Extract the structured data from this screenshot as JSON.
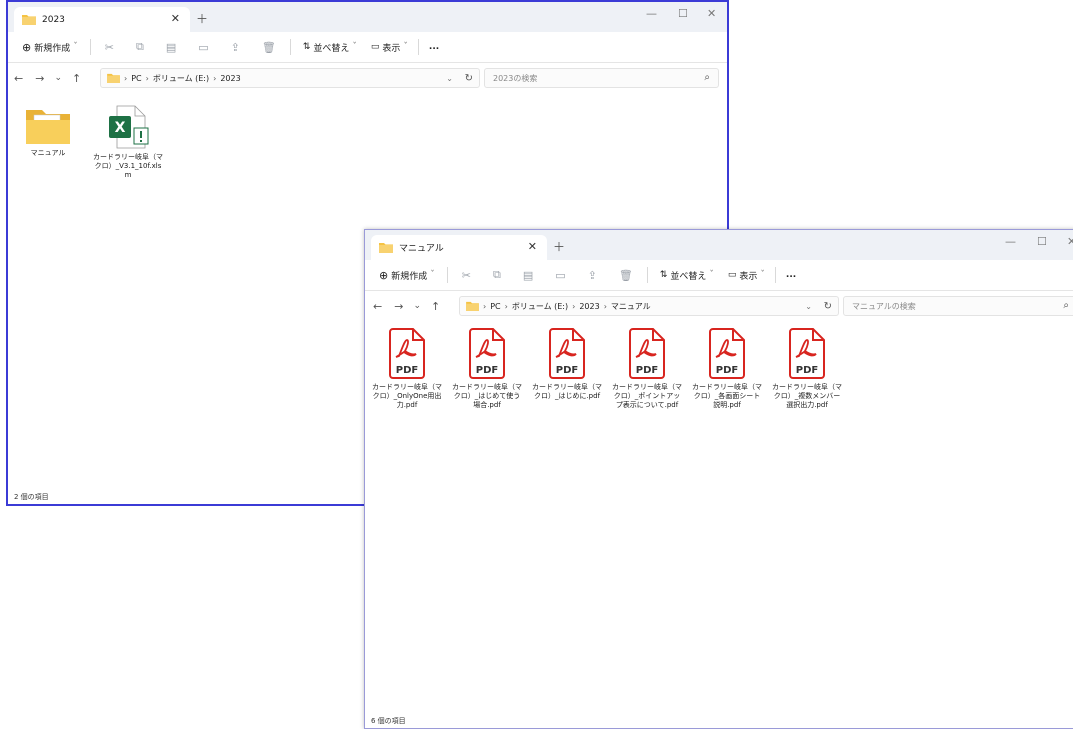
{
  "window1": {
    "tab_title": "2023",
    "toolbar": {
      "new_label": "新規作成",
      "sort_label": "並べ替え",
      "view_label": "表示",
      "more": "..."
    },
    "breadcrumb": [
      "PC",
      "ボリューム (E:)",
      "2023"
    ],
    "search_placeholder": "2023の検索",
    "items": [
      {
        "name": "マニュアル",
        "type": "folder"
      },
      {
        "name": "カードラリー岐阜（マクロ）_V3.1_10f.xlsm",
        "type": "xlsm"
      }
    ],
    "status": "2 個の項目"
  },
  "window2": {
    "tab_title": "マニュアル",
    "toolbar": {
      "new_label": "新規作成",
      "sort_label": "並べ替え",
      "view_label": "表示",
      "more": "..."
    },
    "breadcrumb": [
      "PC",
      "ボリューム (E:)",
      "2023",
      "マニュアル"
    ],
    "search_placeholder": "マニュアルの検索",
    "pdf_badge": "PDF",
    "items": [
      {
        "name": "カードラリー岐阜（マクロ）_OnlyOne用出力.pdf"
      },
      {
        "name": "カードラリー岐阜（マクロ）_はじめて使う場合.pdf"
      },
      {
        "name": "カードラリー岐阜（マクロ）_はじめに.pdf"
      },
      {
        "name": "カードラリー岐阜（マクロ）_ポイントアップ表示について.pdf"
      },
      {
        "name": "カードラリー岐阜（マクロ）_各画面シート説明.pdf"
      },
      {
        "name": "カードラリー岐阜（マクロ）_複数メンバー選択出力.pdf"
      }
    ],
    "status": "6 個の項目"
  },
  "colors": {
    "accent_border": "#3b3bd6",
    "pdf_red": "#d8251f",
    "excel_green": "#1e7145",
    "folder_yellow": "#f5c343"
  },
  "icons": [
    "folder-icon",
    "excel-file-icon",
    "pdf-file-icon",
    "search-icon",
    "refresh-icon",
    "up-arrow-icon"
  ]
}
